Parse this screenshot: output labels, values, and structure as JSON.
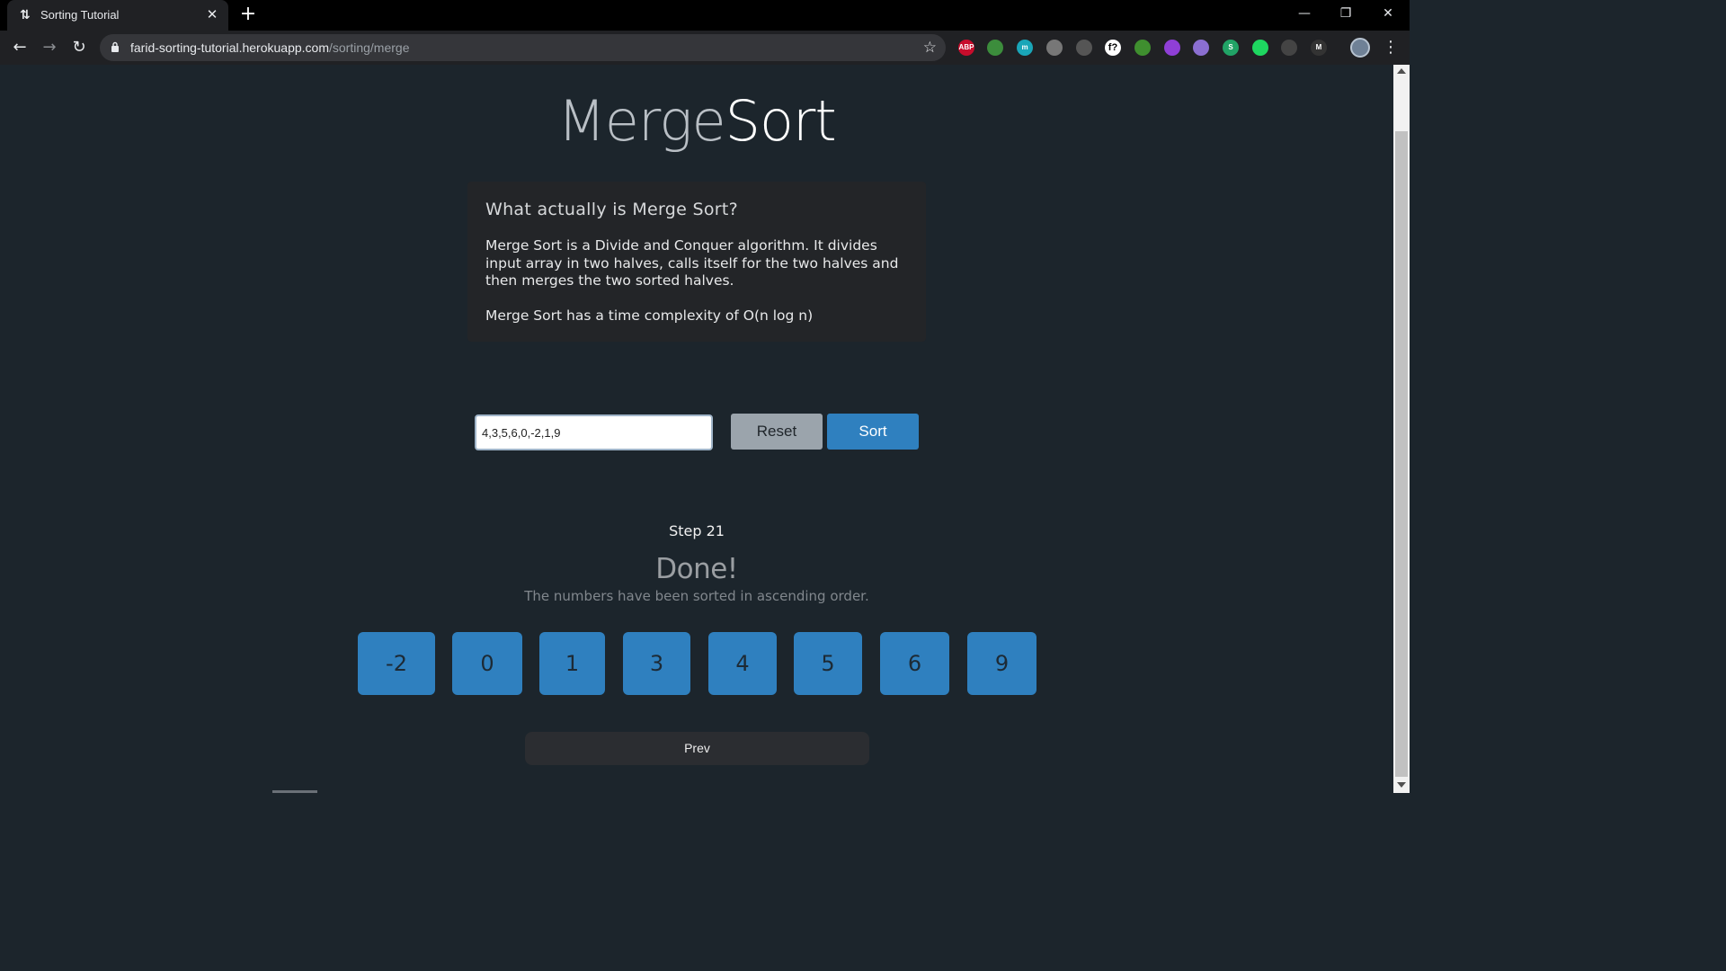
{
  "browser": {
    "tab_title": "Sorting Tutorial",
    "url_host": "farid-sorting-tutorial.herokuapp.com",
    "url_path": "/sorting/merge",
    "extensions": [
      {
        "name": "adblock-plus-icon",
        "label": "ABP",
        "color": "#c70d2c"
      },
      {
        "name": "colorful-extension-icon",
        "label": "",
        "color": "#3c8d3c"
      },
      {
        "name": "m-extension-icon",
        "label": "m",
        "color": "#1aa6b8"
      },
      {
        "name": "grey-extension-icon",
        "label": "",
        "color": "#777777"
      },
      {
        "name": "pen-extension-icon",
        "label": "",
        "color": "#555555"
      },
      {
        "name": "f-extension-icon",
        "label": "f?",
        "color": "#ffffff"
      },
      {
        "name": "tree-extension-icon",
        "label": "",
        "color": "#3f8f2f"
      },
      {
        "name": "purple-extension-icon",
        "label": "",
        "color": "#8f3fd6"
      },
      {
        "name": "pdf-extension-icon",
        "label": "",
        "color": "#8b6fd1"
      },
      {
        "name": "s-extension-icon",
        "label": "S",
        "color": "#21a366"
      },
      {
        "name": "green-extension-icon",
        "label": "",
        "color": "#1ed760"
      },
      {
        "name": "grid-extension-icon",
        "label": "",
        "color": "#444444"
      },
      {
        "name": "m-dark-extension-icon",
        "label": "M",
        "color": "#333333"
      }
    ]
  },
  "page": {
    "title_part1": "Merge",
    "title_part2": "Sort",
    "info": {
      "heading": "What actually is Merge Sort?",
      "paragraph1": "Merge Sort is a Divide and Conquer algorithm. It divides input array in two halves, calls itself for the two halves and then merges the two sorted halves.",
      "paragraph2": "Merge Sort has a time complexity of O(n log n)"
    },
    "controls": {
      "input_value": "4,3,5,6,0,-2,1,9",
      "reset_label": "Reset",
      "sort_label": "Sort"
    },
    "step_label": "Step 21",
    "done_title": "Done!",
    "done_subtitle": "The numbers have been sorted in ascending order.",
    "sorted_numbers": [
      "-2",
      "0",
      "1",
      "3",
      "4",
      "5",
      "6",
      "9"
    ],
    "prev_label": "Prev"
  }
}
